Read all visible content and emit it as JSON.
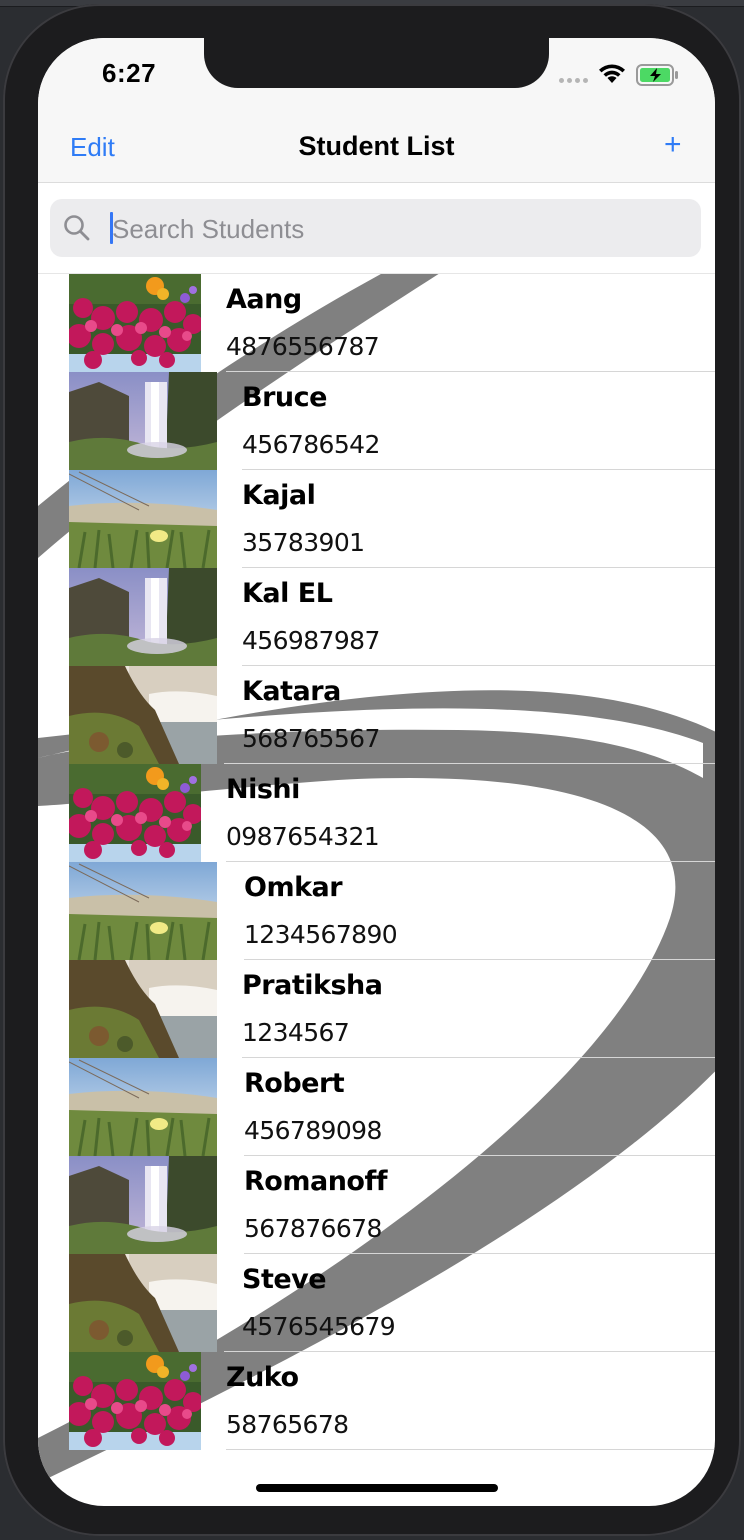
{
  "status_bar": {
    "time": "6:27"
  },
  "nav": {
    "edit_label": "Edit",
    "title": "Student List",
    "add_label": "+"
  },
  "search": {
    "placeholder": "Search Students",
    "value": ""
  },
  "students": [
    {
      "name": "Aang",
      "phone": "4876556787",
      "photo": "flowers"
    },
    {
      "name": "Bruce",
      "phone": "456786542",
      "photo": "waterfall"
    },
    {
      "name": "Kajal",
      "phone": "35783901",
      "photo": "meadow"
    },
    {
      "name": "Kal EL",
      "phone": "456987987",
      "photo": "waterfall"
    },
    {
      "name": "Katara",
      "phone": "568765567",
      "photo": "rockfall"
    },
    {
      "name": "Nishi",
      "phone": "0987654321",
      "photo": "flowers"
    },
    {
      "name": "Omkar",
      "phone": "1234567890",
      "photo": "meadow"
    },
    {
      "name": "Pratiksha",
      "phone": "1234567",
      "photo": "rockfall"
    },
    {
      "name": "Robert",
      "phone": "456789098",
      "photo": "meadow"
    },
    {
      "name": "Romanoff",
      "phone": "567876678",
      "photo": "waterfall"
    },
    {
      "name": "Steve",
      "phone": "4576545679",
      "photo": "rockfall"
    },
    {
      "name": "Zuko",
      "phone": "58765678",
      "photo": "flowers"
    }
  ],
  "icons": {
    "search": "search-icon",
    "wifi": "wifi-icon",
    "battery": "battery-charging-icon",
    "signal": "cellular-signal-icon",
    "add": "plus-icon"
  },
  "colors": {
    "accent": "#2f7cf6",
    "nav_background": "#f7f7f7",
    "search_field": "#ececee",
    "swoosh": "#7f7f7f"
  }
}
